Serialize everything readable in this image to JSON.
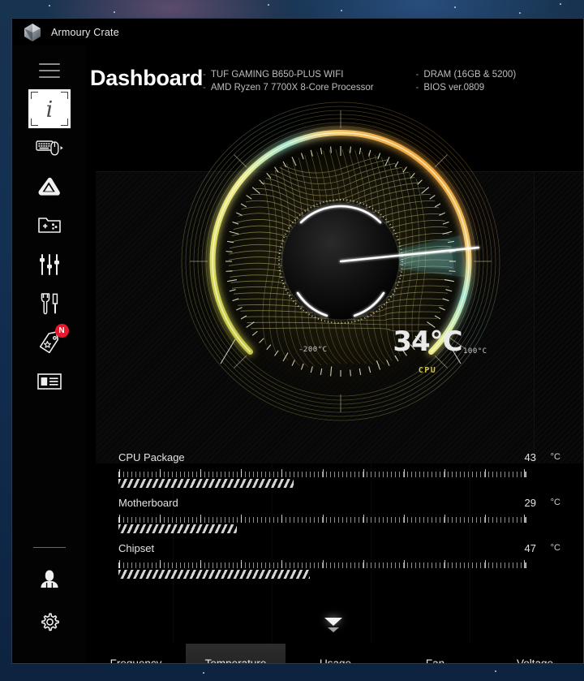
{
  "window": {
    "app_title": "Armoury Crate",
    "logo_icon": "armoury-crate-hex-logo"
  },
  "sidebar": {
    "menu_icon": "hamburger-menu-icon",
    "items": [
      {
        "name": "device-info",
        "icon": "info-i-icon",
        "active": true
      },
      {
        "name": "keyboard-mouse",
        "icon": "keyboard-mouse-icon",
        "active": false
      },
      {
        "name": "aura-sync",
        "icon": "aura-triangle-icon",
        "active": false
      },
      {
        "name": "game-library",
        "icon": "gamepad-folder-icon",
        "active": false
      },
      {
        "name": "scenario-profiles",
        "icon": "sliders-icon",
        "active": false
      },
      {
        "name": "tools",
        "icon": "wrench-screwdriver-icon",
        "active": false
      },
      {
        "name": "featured-deals",
        "icon": "price-tag-icon",
        "active": false,
        "badge": "N"
      },
      {
        "name": "news",
        "icon": "news-card-icon",
        "active": false
      }
    ],
    "bottom_items": [
      {
        "name": "user-account",
        "icon": "user-avatar-icon"
      },
      {
        "name": "settings",
        "icon": "gear-icon"
      }
    ]
  },
  "header": {
    "page_title": "Dashboard",
    "sysinfo_col1": [
      "TUF GAMING B650-PLUS WIFI",
      "AMD Ryzen 7 7700X 8-Core Processor"
    ],
    "sysinfo_col2": [
      "DRAM (16GB & 5200)",
      "BIOS ver.0809"
    ]
  },
  "gauge": {
    "value": "34°C",
    "label": "CPU",
    "range_min_label": "-200°C",
    "range_max_label": "100°C",
    "label_color": "#cfc24a",
    "needle_color": "#ffffff"
  },
  "chart_data": {
    "type": "bar",
    "title": "Temperature",
    "categories": [
      "CPU Package",
      "Motherboard",
      "Chipset"
    ],
    "values": [
      43,
      29,
      47
    ],
    "unit": "°C",
    "xlabel": "",
    "ylabel": "",
    "ylim": [
      0,
      100
    ],
    "grid": false,
    "legend": "none",
    "annotations": [
      "Gauge: CPU 34°C (range -200°C to 100°C)"
    ]
  },
  "metrics": [
    {
      "name": "CPU Package",
      "value": "43",
      "unit": "°C",
      "percent": 43
    },
    {
      "name": "Motherboard",
      "value": "29",
      "unit": "°C",
      "percent": 29
    },
    {
      "name": "Chipset",
      "value": "47",
      "unit": "°C",
      "percent": 47
    }
  ],
  "expand": {
    "icon": "double-chevron-down-icon"
  },
  "tabs": [
    {
      "label": "Frequency",
      "active": false
    },
    {
      "label": "Temperature",
      "active": true
    },
    {
      "label": "Usage",
      "active": false
    },
    {
      "label": "Fan",
      "active": false
    },
    {
      "label": "Voltage",
      "active": false
    }
  ],
  "colors": {
    "accent_yellow": "#d8d24a",
    "accent_orange": "#e89a2a",
    "accent_cyan": "#6fd8d8",
    "badge_red": "#e8192c",
    "window_bg": "#000000"
  }
}
